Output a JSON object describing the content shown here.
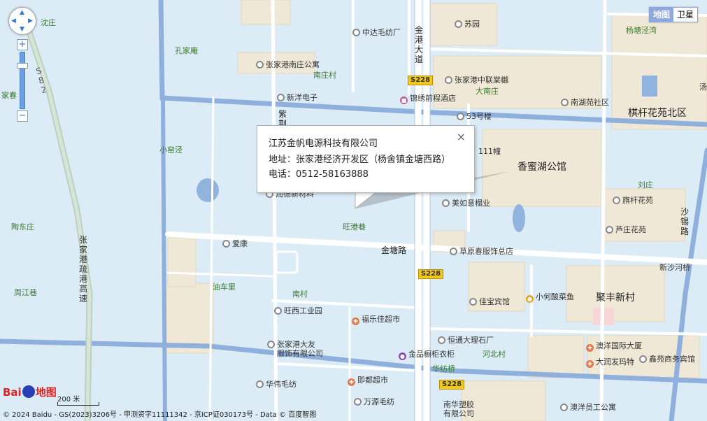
{
  "map_type": {
    "map": "地图",
    "satellite": "卫星"
  },
  "controls": {
    "zoom_in": "+",
    "zoom_out": "−"
  },
  "popup": {
    "company": "江苏金帆电源科技有限公司",
    "address": "地址：张家港经济开发区（杨舍镇金塘西路）",
    "phone": "电话：0512-58163888",
    "close": "×"
  },
  "places": {
    "shenzhuang": "沈庄",
    "kongjiashe": "孔家庵",
    "jiachun": "家春",
    "xiaoyaojing": "小窑泾",
    "taodongzhuang": "陶东庄",
    "zhoujiangxiang": "周江巷",
    "nanzhuangcun": "南庄村",
    "dazhuang": "大南庄",
    "liuzhuang": "刘庄",
    "wanggangxiang": "旺港巷",
    "youcheli": "油车里",
    "nancun": "南村",
    "hebeicun": "河北村",
    "huajiqiao": "华纺桥",
    "yangjingwan": "杨塘泾湾",
    "tang": "汤",
    "xinshaheqiao": "新沙河桥"
  },
  "big_labels": {
    "qiganhuayuan": "棋杆花苑北区",
    "xiangmihu": "香蜜湖公馆",
    "jufengxincun": "聚丰新村"
  },
  "roads": {
    "jintang": "金塘路",
    "jingang": "金港大道",
    "zijing": "紫荆",
    "highway": "张家港疏港高速",
    "shaxi": "沙锡路",
    "s82": "S82"
  },
  "shields": {
    "s228": "S228"
  },
  "pois": {
    "zhongda": "中达毛纺厂",
    "suyuan": "苏园",
    "nanzhuang_apt": "张家港南庄公寓",
    "zhonglian": "张家港中联棠樾",
    "xinyang": "新洋电子",
    "jinxiu": "锦绣前程酒店",
    "nanhu": "南湖苑社区",
    "lou53": "53号楼",
    "mansion111": "111幢",
    "runzhi": "润德新材料",
    "meiru": "美如意榻业",
    "qigan": "旗杆花苑",
    "luzhuang": "芦庄花苑",
    "aikang": "爱康",
    "caoyuanchun": "草原春服饰总店",
    "wangxi": "旺西工业园",
    "fule": "福乐佳超市",
    "jiabao": "佳宝宾馆",
    "xiaohe": "小何酸菜鱼",
    "dayou": "张家港大友",
    "dayou2": "服饰有限公司",
    "hengtong": "恒通大理石厂",
    "jinpin": "金品橱柜衣柜",
    "aoyang": "澳洋国际大厦",
    "dadou": "大润发玛特",
    "xinyuan": "鑫苑商务宾馆",
    "huawei": "华伟毛纺",
    "nidou": "即都超市",
    "wanyuan": "万源毛纺",
    "nanhua": "南华塑胶",
    "nanhua2": "有限公司",
    "aoyang_staff": "澳洋员工公寓"
  },
  "scale": {
    "label": "200 米"
  },
  "logo": {
    "text1": "Bai",
    "text2": "地图"
  },
  "footer": "© 2024 Baidu - GS(2023)3206号 - 甲测资字11111342 - 京ICP证030173号 - Data © 百度智图"
}
